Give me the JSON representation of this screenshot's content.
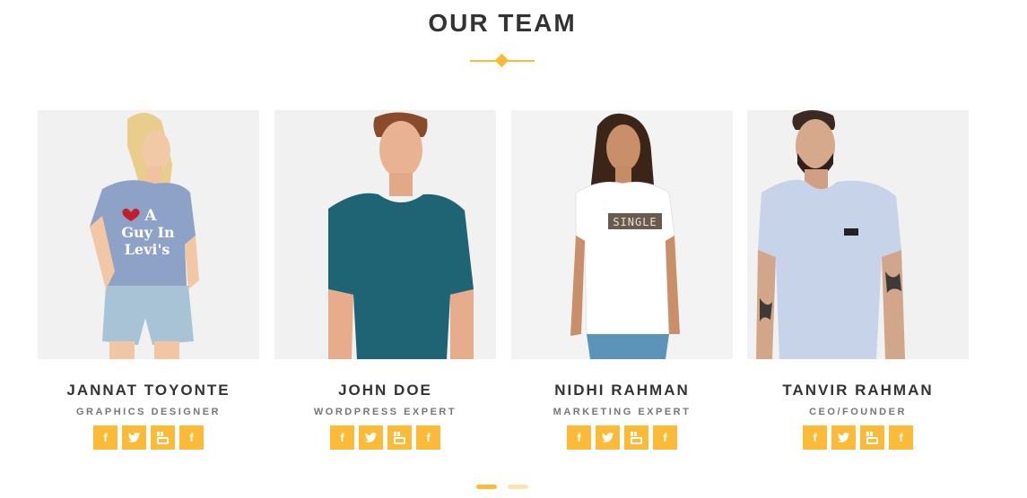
{
  "section": {
    "title": "OUR TEAM"
  },
  "colors": {
    "accent": "#fbba38",
    "accent_light": "#fde3ae",
    "heading": "#333333",
    "role": "#777777",
    "photo_bg": "#f1f1f1"
  },
  "team": [
    {
      "name": "JANNAT TOYONTE",
      "role": "GRAPHICS DESIGNER",
      "shirt_text_line1": "A",
      "shirt_text_line2": "Guy In",
      "shirt_text_line3": "Levi's",
      "socials": [
        "facebook-icon",
        "twitter-icon",
        "youtube-icon",
        "facebook-icon"
      ]
    },
    {
      "name": "JOHN DOE",
      "role": "WORDPRESS EXPERT",
      "socials": [
        "facebook-icon",
        "twitter-icon",
        "youtube-icon",
        "facebook-icon"
      ]
    },
    {
      "name": "NIDHI RAHMAN",
      "role": "MARKETING EXPERT",
      "shirt_text_line1": "SINGLE",
      "socials": [
        "facebook-icon",
        "twitter-icon",
        "youtube-icon",
        "facebook-icon"
      ]
    },
    {
      "name": "TANVIR RAHMAN",
      "role": "CEO/FOUNDER",
      "socials": [
        "facebook-icon",
        "twitter-icon",
        "youtube-icon",
        "facebook-icon"
      ]
    }
  ],
  "pager": {
    "active_index": 0,
    "count": 2
  }
}
